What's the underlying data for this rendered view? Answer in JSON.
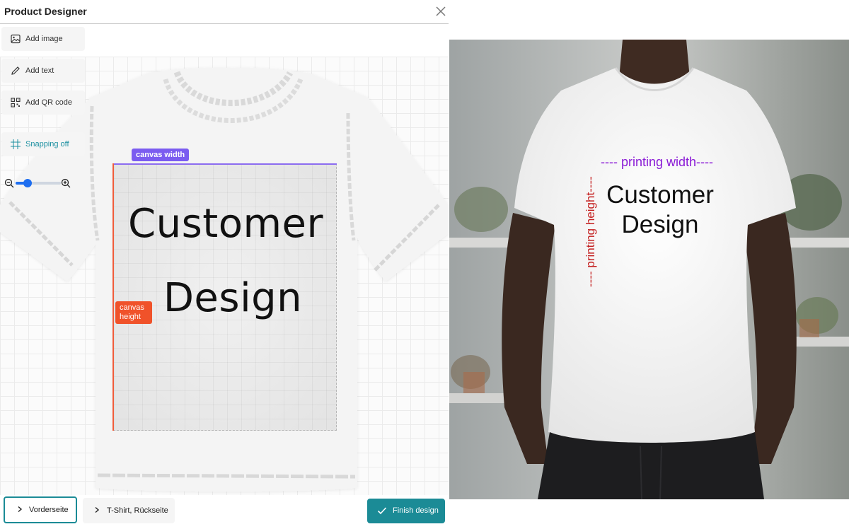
{
  "header": {
    "title": "Product Designer",
    "close_icon": "close-icon"
  },
  "toolbar": {
    "add_image": {
      "label": "Add image",
      "icon": "image-icon"
    },
    "add_text": {
      "label": "Add text",
      "icon": "pencil-icon"
    },
    "add_qr": {
      "label": "Add QR code",
      "icon": "qr-code-icon"
    },
    "snapping": {
      "label": "Snapping off",
      "icon": "grid-icon",
      "color": "#1a8fa0"
    }
  },
  "zoom": {
    "level": 0.27,
    "zoom_out_icon": "zoom-out-icon",
    "zoom_in_icon": "zoom-in-icon"
  },
  "canvas": {
    "width_label": "canvas width",
    "height_label": "canvas height",
    "design_line1": "Customer",
    "design_line2": "Design",
    "width_color": "#7b5cf0",
    "height_color": "#f0522a"
  },
  "footer": {
    "front_label": "Vorderseite",
    "back_label": "T-Shirt, Rückseite",
    "finish_label": "Finish design",
    "accent": "#1b8b96"
  },
  "photo": {
    "printing_width": "---- printing width----",
    "printing_height": "---- printing height----",
    "design_line1": "Customer",
    "design_line2": "Design"
  }
}
